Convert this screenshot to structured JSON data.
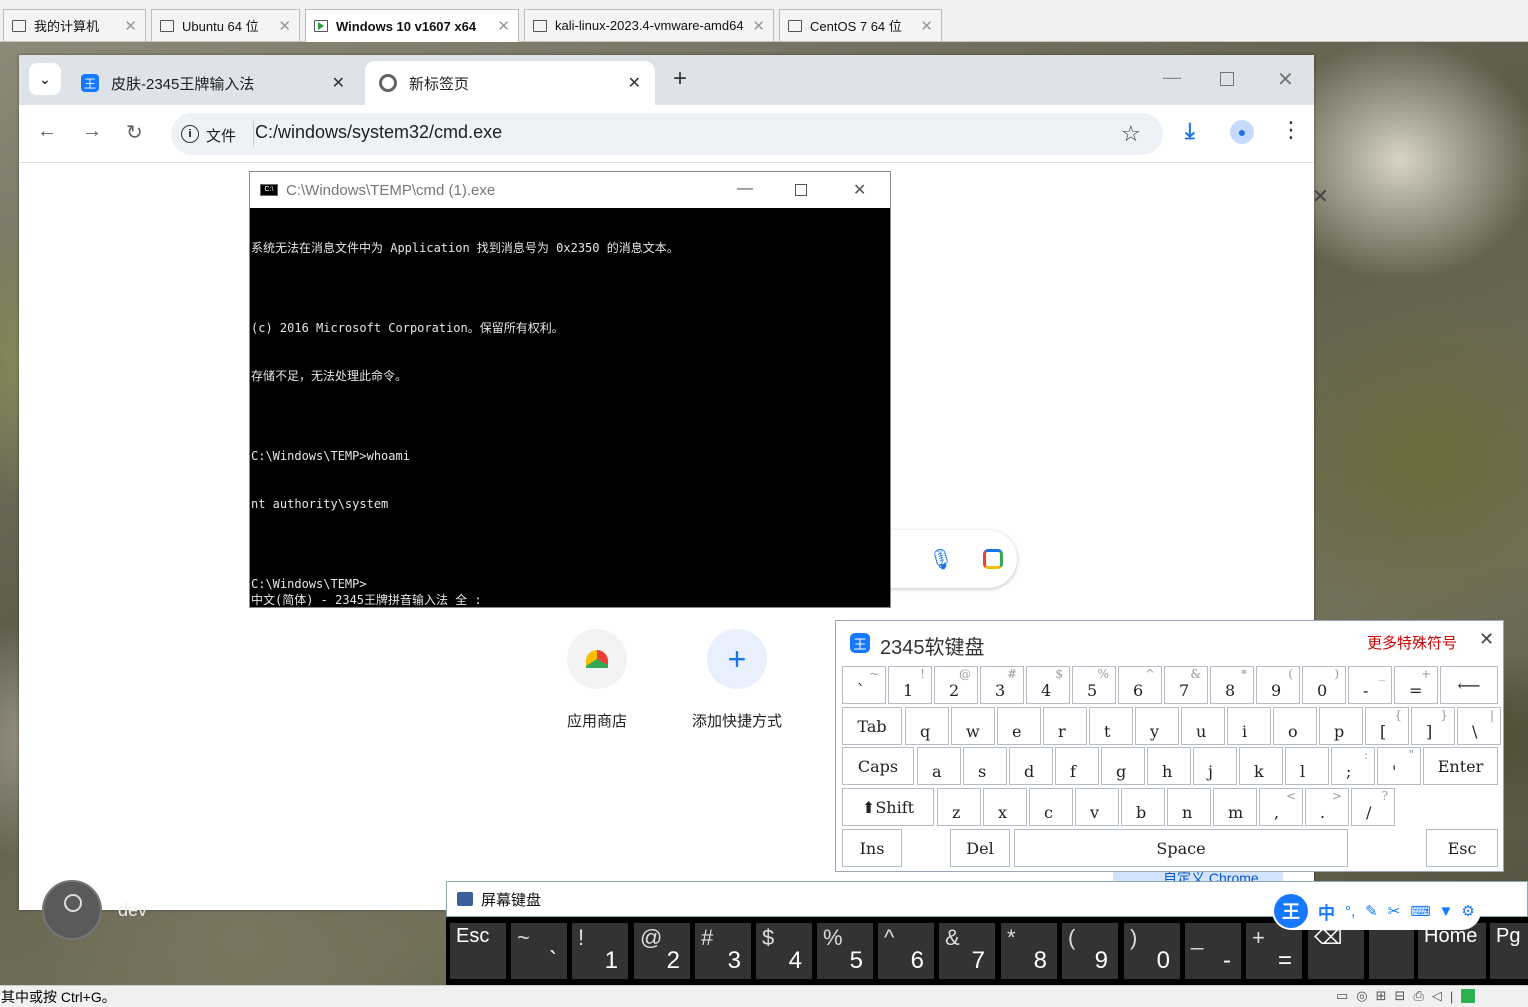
{
  "vm_tabs": [
    {
      "label": "我的计算机"
    },
    {
      "label": "Ubuntu 64 位"
    },
    {
      "label": "Windows 10 v1607 x64"
    },
    {
      "label": "kali-linux-2023.4-vmware-amd64"
    },
    {
      "label": "CentOS 7 64 位"
    }
  ],
  "chrome": {
    "tabs": [
      {
        "label": "皮肤-2345王牌输入法"
      },
      {
        "label": "新标签页"
      }
    ],
    "url_chip": "文件",
    "url": "C:/windows/system32/cmd.exe",
    "shortcuts": [
      {
        "label": "应用商店"
      },
      {
        "label": "添加快捷方式"
      }
    ],
    "customize_label": "自定义 Chrome",
    "profile_name": "dev"
  },
  "cmd": {
    "title": "C:\\Windows\\TEMP\\cmd (1).exe",
    "lines": [
      "系统无法在消息文件中为 Application 找到消息号为 0x2350 的消息文本。",
      "",
      "(c) 2016 Microsoft Corporation。保留所有权利。",
      "存储不足，无法处理此命令。",
      "",
      "C:\\Windows\\TEMP>whoami",
      "nt authority\\system",
      "",
      "C:\\Windows\\TEMP>"
    ],
    "ime_status": "中文(简体) - 2345王牌拼音输入法 全 :"
  },
  "softkb": {
    "title": "2345软键盘",
    "more_symbols": "更多特殊符号",
    "rows": [
      [
        {
          "m": "`",
          "u": "~"
        },
        {
          "m": "1",
          "u": "!"
        },
        {
          "m": "2",
          "u": "@"
        },
        {
          "m": "3",
          "u": "#"
        },
        {
          "m": "4",
          "u": "$"
        },
        {
          "m": "5",
          "u": "%"
        },
        {
          "m": "6",
          "u": "^"
        },
        {
          "m": "7",
          "u": "&"
        },
        {
          "m": "8",
          "u": "*"
        },
        {
          "m": "9",
          "u": "("
        },
        {
          "m": "0",
          "u": ")"
        },
        {
          "m": "-",
          "u": "_"
        },
        {
          "m": "=",
          "u": "+"
        }
      ],
      [
        {
          "m": "q"
        },
        {
          "m": "w"
        },
        {
          "m": "e"
        },
        {
          "m": "r"
        },
        {
          "m": "t"
        },
        {
          "m": "y"
        },
        {
          "m": "u"
        },
        {
          "m": "i"
        },
        {
          "m": "o"
        },
        {
          "m": "p"
        },
        {
          "m": "[",
          "u": "{"
        },
        {
          "m": "]",
          "u": "}"
        },
        {
          "m": "\\",
          "u": "|"
        }
      ],
      [
        {
          "m": "a"
        },
        {
          "m": "s"
        },
        {
          "m": "d"
        },
        {
          "m": "f"
        },
        {
          "m": "g"
        },
        {
          "m": "h"
        },
        {
          "m": "j"
        },
        {
          "m": "k"
        },
        {
          "m": "l"
        },
        {
          "m": ";",
          "u": ":"
        },
        {
          "m": "'",
          "u": "\""
        }
      ],
      [
        {
          "m": "z"
        },
        {
          "m": "x"
        },
        {
          "m": "c"
        },
        {
          "m": "v"
        },
        {
          "m": "b"
        },
        {
          "m": "n"
        },
        {
          "m": "m"
        },
        {
          "m": ",",
          "u": "<"
        },
        {
          "m": ".",
          "u": ">"
        },
        {
          "m": "/",
          "u": "?"
        }
      ]
    ],
    "keys": {
      "tab": "Tab",
      "caps": "Caps",
      "enter": "Enter",
      "shift": "⬆Shift",
      "ins": "Ins",
      "del": "Del",
      "space": "Space",
      "esc": "Esc",
      "backspace": "⟵"
    }
  },
  "osk": {
    "title": "屏幕键盘",
    "keys": [
      {
        "w": "Esc"
      },
      {
        "t": "~",
        "b": "`"
      },
      {
        "t": "!",
        "b": "1"
      },
      {
        "t": "@",
        "b": "2"
      },
      {
        "t": "#",
        "b": "3"
      },
      {
        "t": "$",
        "b": "4"
      },
      {
        "t": "%",
        "b": "5"
      },
      {
        "t": "^",
        "b": "6"
      },
      {
        "t": "&",
        "b": "7"
      },
      {
        "t": "*",
        "b": "8"
      },
      {
        "t": "(",
        "b": "9"
      },
      {
        "t": ")",
        "b": "0"
      },
      {
        "t": "_",
        "b": "-"
      },
      {
        "t": "+",
        "b": "="
      },
      {
        "w": "⌫"
      },
      {
        "w": ""
      },
      {
        "w": "Home"
      },
      {
        "w": "Pg"
      }
    ],
    "ime_toolbar": [
      "中"
    ]
  },
  "statusbar": {
    "text": "其中或按 Ctrl+G。"
  },
  "colors": {
    "accent": "#1a73e8",
    "ime_blue": "#1677ff",
    "more_red": "#cc0000"
  }
}
